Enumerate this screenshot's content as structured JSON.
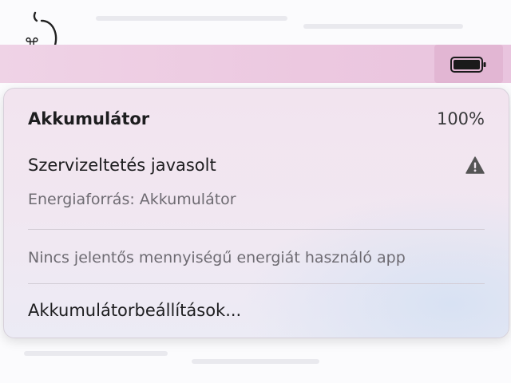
{
  "menubar": {
    "battery_icon": "battery-full-icon",
    "logo_icon": "apple-logo-icon"
  },
  "battery_menu": {
    "title": "Akkumulátor",
    "percent": "100%",
    "service_label": "Szervizeltetés javasolt",
    "service_icon": "warning-triangle-icon",
    "power_source": "Energiaforrás: Akkumulátor",
    "no_apps": "Nincs jelentős mennyiségű energiát használó app",
    "settings": "Akkumulátorbeállítások..."
  },
  "colors": {
    "menubar": "#ecc8e0",
    "menubar_highlight": "#e2b6d3",
    "menu_bg": "#f1e7f1",
    "text_primary": "#1d1d1f",
    "text_secondary": "#6e6b72"
  }
}
